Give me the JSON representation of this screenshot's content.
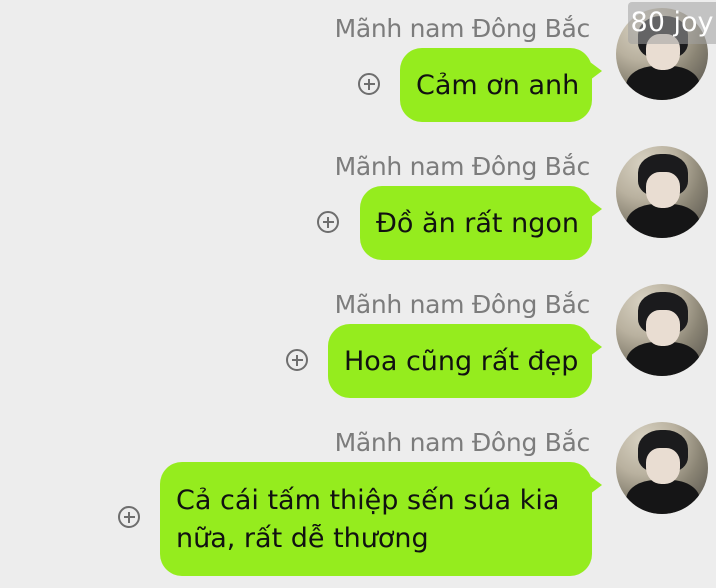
{
  "badge": {
    "text": "80 joy"
  },
  "messages": [
    {
      "sender": "Mãnh nam Đông Bắc",
      "text": "Cảm ơn anh"
    },
    {
      "sender": "Mãnh nam Đông Bắc",
      "text": "Đồ ăn rất ngon"
    },
    {
      "sender": "Mãnh nam Đông Bắc",
      "text": "Hoa cũng rất đẹp"
    },
    {
      "sender": "Mãnh nam Đông Bắc",
      "text": "Cả cái tấm thiệp sến súa kia nữa, rất dễ thương"
    }
  ],
  "colors": {
    "bubble": "#95ec1e",
    "background": "#ededed",
    "sender_text": "#7c7c7c"
  },
  "icons": {
    "add": "plus-circle-icon"
  }
}
